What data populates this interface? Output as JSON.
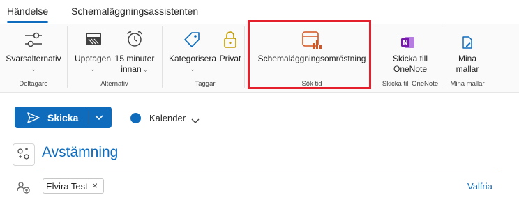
{
  "tabs": [
    {
      "label": "Händelse",
      "active": true
    },
    {
      "label": "Schemaläggningsassistenten",
      "active": false
    }
  ],
  "ribbon": {
    "commands": {
      "response_options": "Svarsalternativ",
      "show_as": "Upptagen",
      "reminder_line1": "15 minuter",
      "reminder_line2": "innan",
      "categorize": "Kategorisera",
      "private": "Privat",
      "scheduling_poll": "Schemaläggningsomröstning",
      "send_onenote_line1": "Skicka till",
      "send_onenote_line2": "OneNote",
      "my_templates_line1": "Mina",
      "my_templates_line2": "mallar"
    },
    "groups": {
      "attendees": "Deltagare",
      "options": "Alternativ",
      "tags": "Taggar",
      "find_time": "Sök tid",
      "send_to_onenote": "Skicka till OneNote",
      "my_templates": "Mina mallar"
    },
    "highlight_color": "#e5202d"
  },
  "compose": {
    "send_label": "Skicka",
    "calendar_label": "Kalender",
    "calendar_color": "#0f6cbd",
    "title": "Avstämning",
    "attendee": "Elvira Test",
    "optional_label": "Valfria"
  },
  "colors": {
    "accent": "#0f6cbd",
    "poll_icon": "#d4551f",
    "onenote": "#7719aa",
    "private_icon": "#c19c00"
  }
}
